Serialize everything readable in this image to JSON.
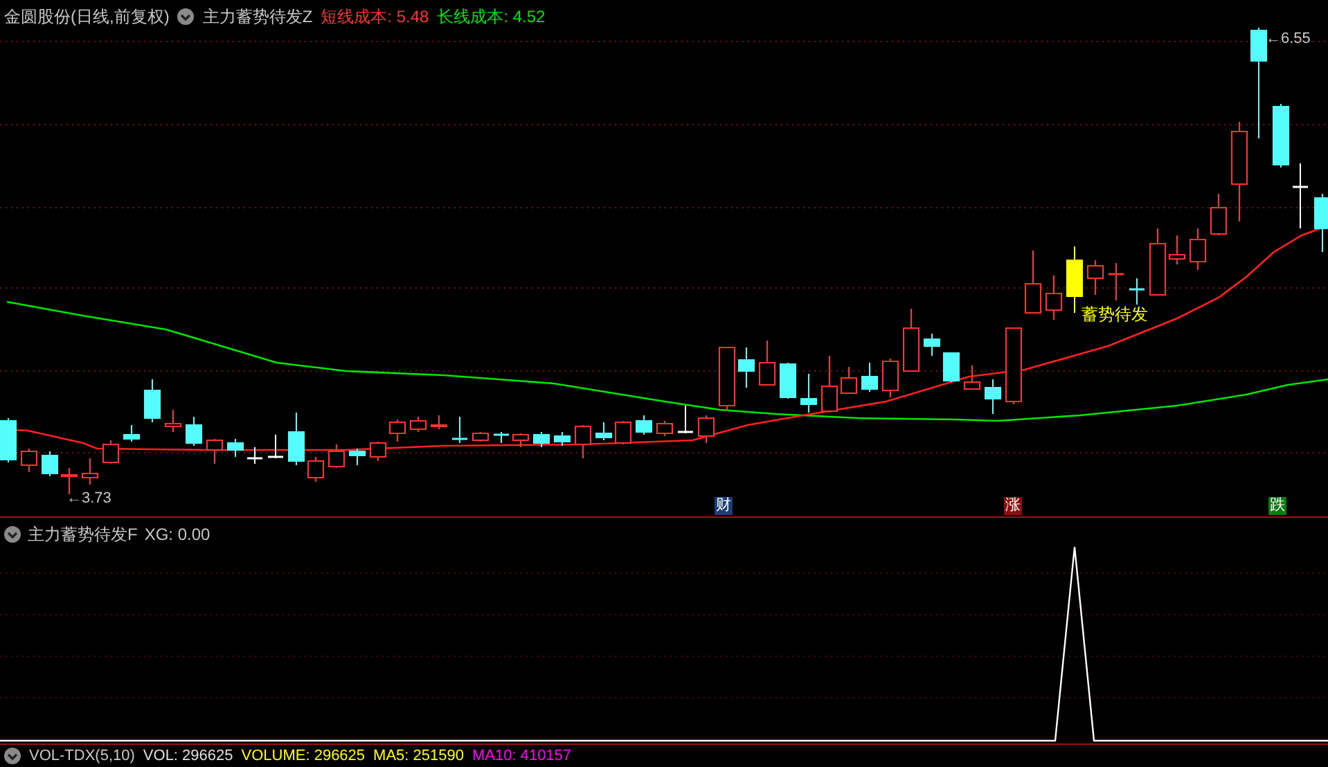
{
  "main_panel": {
    "title": "金圆股份(日线,前复权)",
    "indicator_name": "主力蓄势待发Z",
    "readouts": [
      {
        "label": "短线成本: 5.48",
        "color": "#ff3232"
      },
      {
        "label": "长线成本: 4.52",
        "color": "#00e600"
      }
    ],
    "high_label": "←6.55",
    "low_label": "←3.73",
    "signal_label": "蓄势待发",
    "event_badges": [
      {
        "label": "财",
        "color": "#1c3f7a"
      },
      {
        "label": "涨",
        "color": "#8a1010"
      },
      {
        "label": "跌",
        "color": "#0f7a0f"
      }
    ]
  },
  "indicator_panel": {
    "name": "主力蓄势待发F",
    "readout": "XG: 0.00"
  },
  "volume_panel": {
    "name": "VOL-TDX(5,10)",
    "readouts": [
      {
        "label": "VOL: 296625",
        "color": "#e0e0e0"
      },
      {
        "label": "VOLUME: 296625",
        "color": "#ffff00"
      },
      {
        "label": "MA5: 251590",
        "color": "#ffff00"
      },
      {
        "label": "MA10: 410157",
        "color": "#ff00ff"
      }
    ]
  }
}
